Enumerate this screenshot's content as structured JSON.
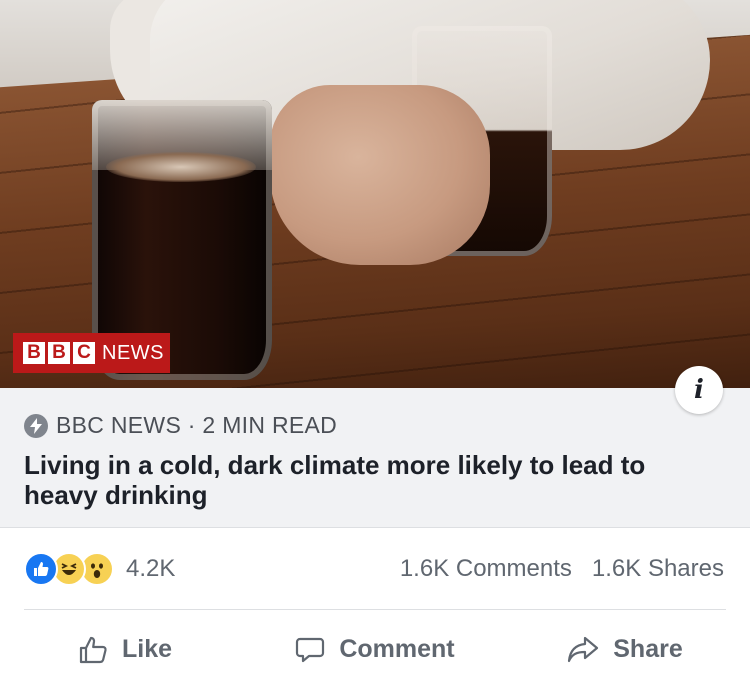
{
  "hero": {
    "logo": {
      "part1": "B",
      "part2": "B",
      "part3": "C",
      "part4": "NEWS"
    },
    "info_glyph": "i"
  },
  "link": {
    "source": "BBC NEWS · 2 MIN READ",
    "headline": "Living in a cold, dark climate more likely to lead to heavy drinking"
  },
  "counts": {
    "reactions": [
      "like",
      "haha",
      "wow"
    ],
    "reactions_total": "4.2K",
    "comments": "1.6K Comments",
    "shares": "1.6K Shares"
  },
  "actions": {
    "like": "Like",
    "comment": "Comment",
    "share": "Share"
  },
  "colors": {
    "bbc_red": "#bb1919",
    "like_blue": "#1877f2",
    "text_secondary": "#606770",
    "meta_bg": "#f1f2f4"
  }
}
